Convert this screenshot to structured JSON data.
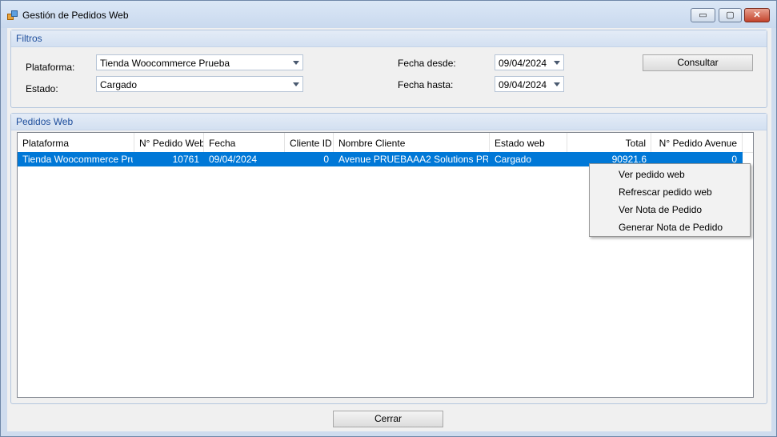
{
  "window": {
    "title": "Gestión de Pedidos Web",
    "min_glyph": "▭",
    "max_glyph": "▢",
    "close_glyph": "✕"
  },
  "filters": {
    "title": "Filtros",
    "plataforma_label": "Plataforma:",
    "plataforma_value": "Tienda Woocommerce Prueba",
    "estado_label": "Estado:",
    "estado_value": "Cargado",
    "fecha_desde_label": "Fecha desde:",
    "fecha_desde_value": "09/04/2024",
    "fecha_hasta_label": "Fecha hasta:",
    "fecha_hasta_value": "09/04/2024",
    "consultar_label": "Consultar"
  },
  "orders": {
    "title": "Pedidos Web",
    "columns": [
      "Plataforma",
      "N° Pedido Web",
      "Fecha",
      "Cliente ID",
      "Nombre Cliente",
      "Estado web",
      "Total",
      "N° Pedido Avenue"
    ],
    "rows": [
      [
        "Tienda Woocommerce Pru...",
        "10761",
        "09/04/2024",
        "0",
        "Avenue PRUEBAAA2 Solutions PR...",
        "Cargado",
        "90921.6",
        "0"
      ]
    ]
  },
  "context_menu": {
    "items": [
      "Ver pedido web",
      "Refrescar pedido web",
      "Ver Nota de Pedido",
      "Generar Nota de Pedido"
    ]
  },
  "footer": {
    "cerrar_label": "Cerrar"
  },
  "colors": {
    "selection": "#0078d7",
    "group_title": "#1e4e9c"
  }
}
